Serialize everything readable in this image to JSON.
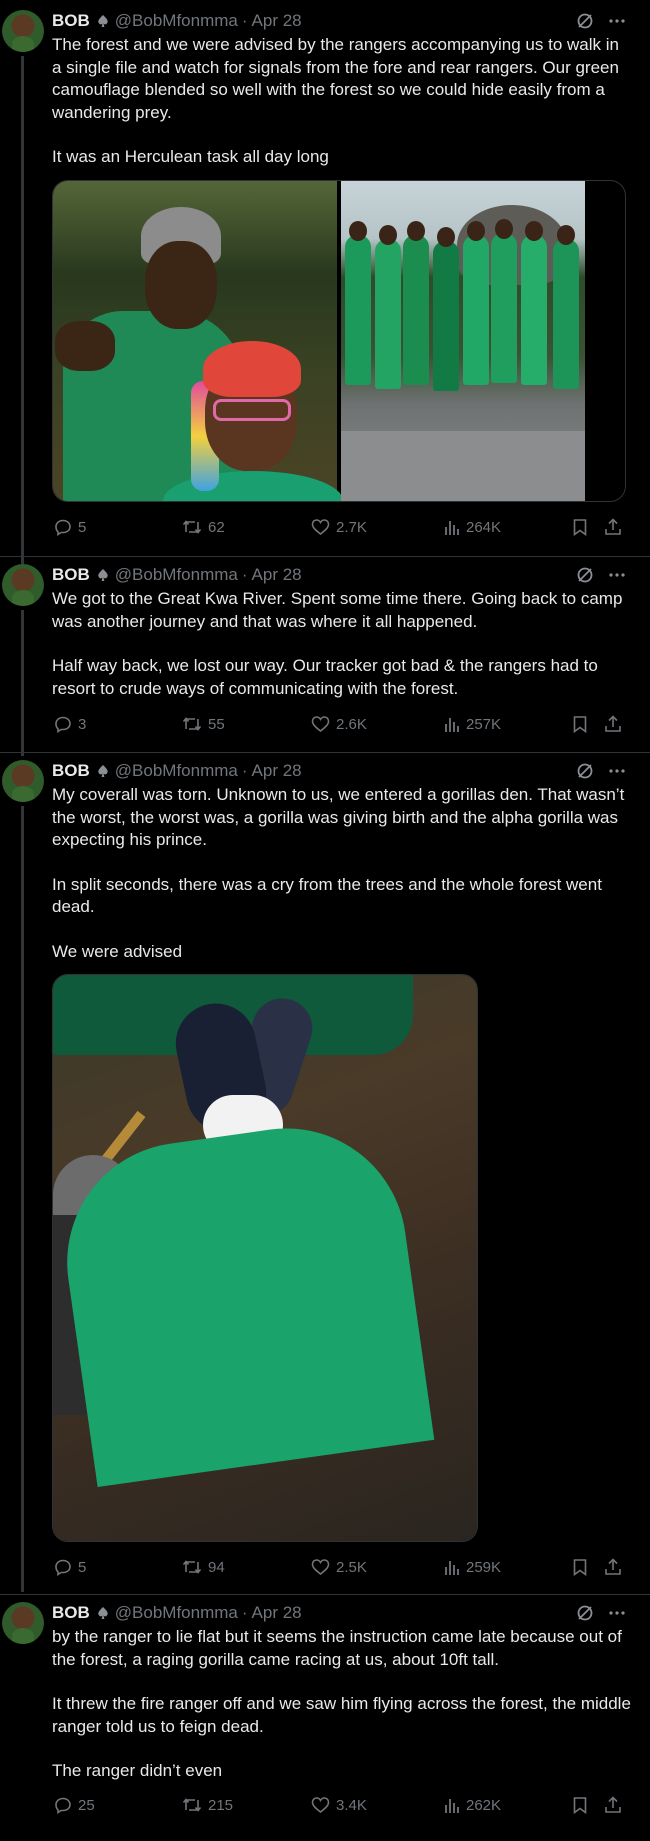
{
  "tweets": [
    {
      "name": "BOB",
      "handle": "@BobMfonmma",
      "dot": "·",
      "date": "Apr 28",
      "paragraphs": [
        "The forest and we were advised by the rangers accompanying us to walk in a single file and watch for signals from the fore and rear rangers. Our green camouflage blended so well with the forest so we could hide easily from a wandering prey.",
        "It was an Herculean task all day long"
      ],
      "stats": {
        "replies": "5",
        "reposts": "62",
        "likes": "2.7K",
        "views": "264K"
      }
    },
    {
      "name": "BOB",
      "handle": "@BobMfonmma",
      "dot": "·",
      "date": "Apr 28",
      "paragraphs": [
        "We got to the Great Kwa River. Spent some time there. Going back to camp was another journey and that was where it all happened.",
        "Half way back, we lost our way. Our tracker got bad & the rangers had to resort to crude ways of communicating with the forest."
      ],
      "stats": {
        "replies": "3",
        "reposts": "55",
        "likes": "2.6K",
        "views": "257K"
      }
    },
    {
      "name": "BOB",
      "handle": "@BobMfonmma",
      "dot": "·",
      "date": "Apr 28",
      "paragraphs": [
        "My coverall was torn. Unknown to us, we entered a gorillas den. That wasn’t the worst, the worst was, a gorilla was giving birth and the alpha gorilla was expecting his prince.",
        "In split seconds, there was a cry from the trees and the whole forest went dead.",
        "We were advised"
      ],
      "stats": {
        "replies": "5",
        "reposts": "94",
        "likes": "2.5K",
        "views": "259K"
      }
    },
    {
      "name": "BOB",
      "handle": "@BobMfonmma",
      "dot": "·",
      "date": "Apr 28",
      "paragraphs": [
        "by the ranger to lie flat but it seems the instruction came late because out of the forest, a raging gorilla came racing at us, about 10ft tall.",
        "It threw the fire ranger off and we saw him flying across the forest, the middle ranger told us to feign dead.",
        "The ranger didn’t even"
      ],
      "stats": {
        "replies": "25",
        "reposts": "215",
        "likes": "3.4K",
        "views": "262K"
      }
    }
  ],
  "icons": {
    "badge": "spade-badge-icon",
    "grok": "grok-icon",
    "more": "more-icon",
    "reply": "reply-icon",
    "repost": "repost-icon",
    "like": "like-icon",
    "views": "views-icon",
    "bookmark": "bookmark-icon",
    "share": "share-icon"
  },
  "colors": {
    "background": "#000000",
    "text": "#e7e9ea",
    "secondary": "#71767b",
    "border": "#2f3336",
    "thread_line": "#333639"
  }
}
